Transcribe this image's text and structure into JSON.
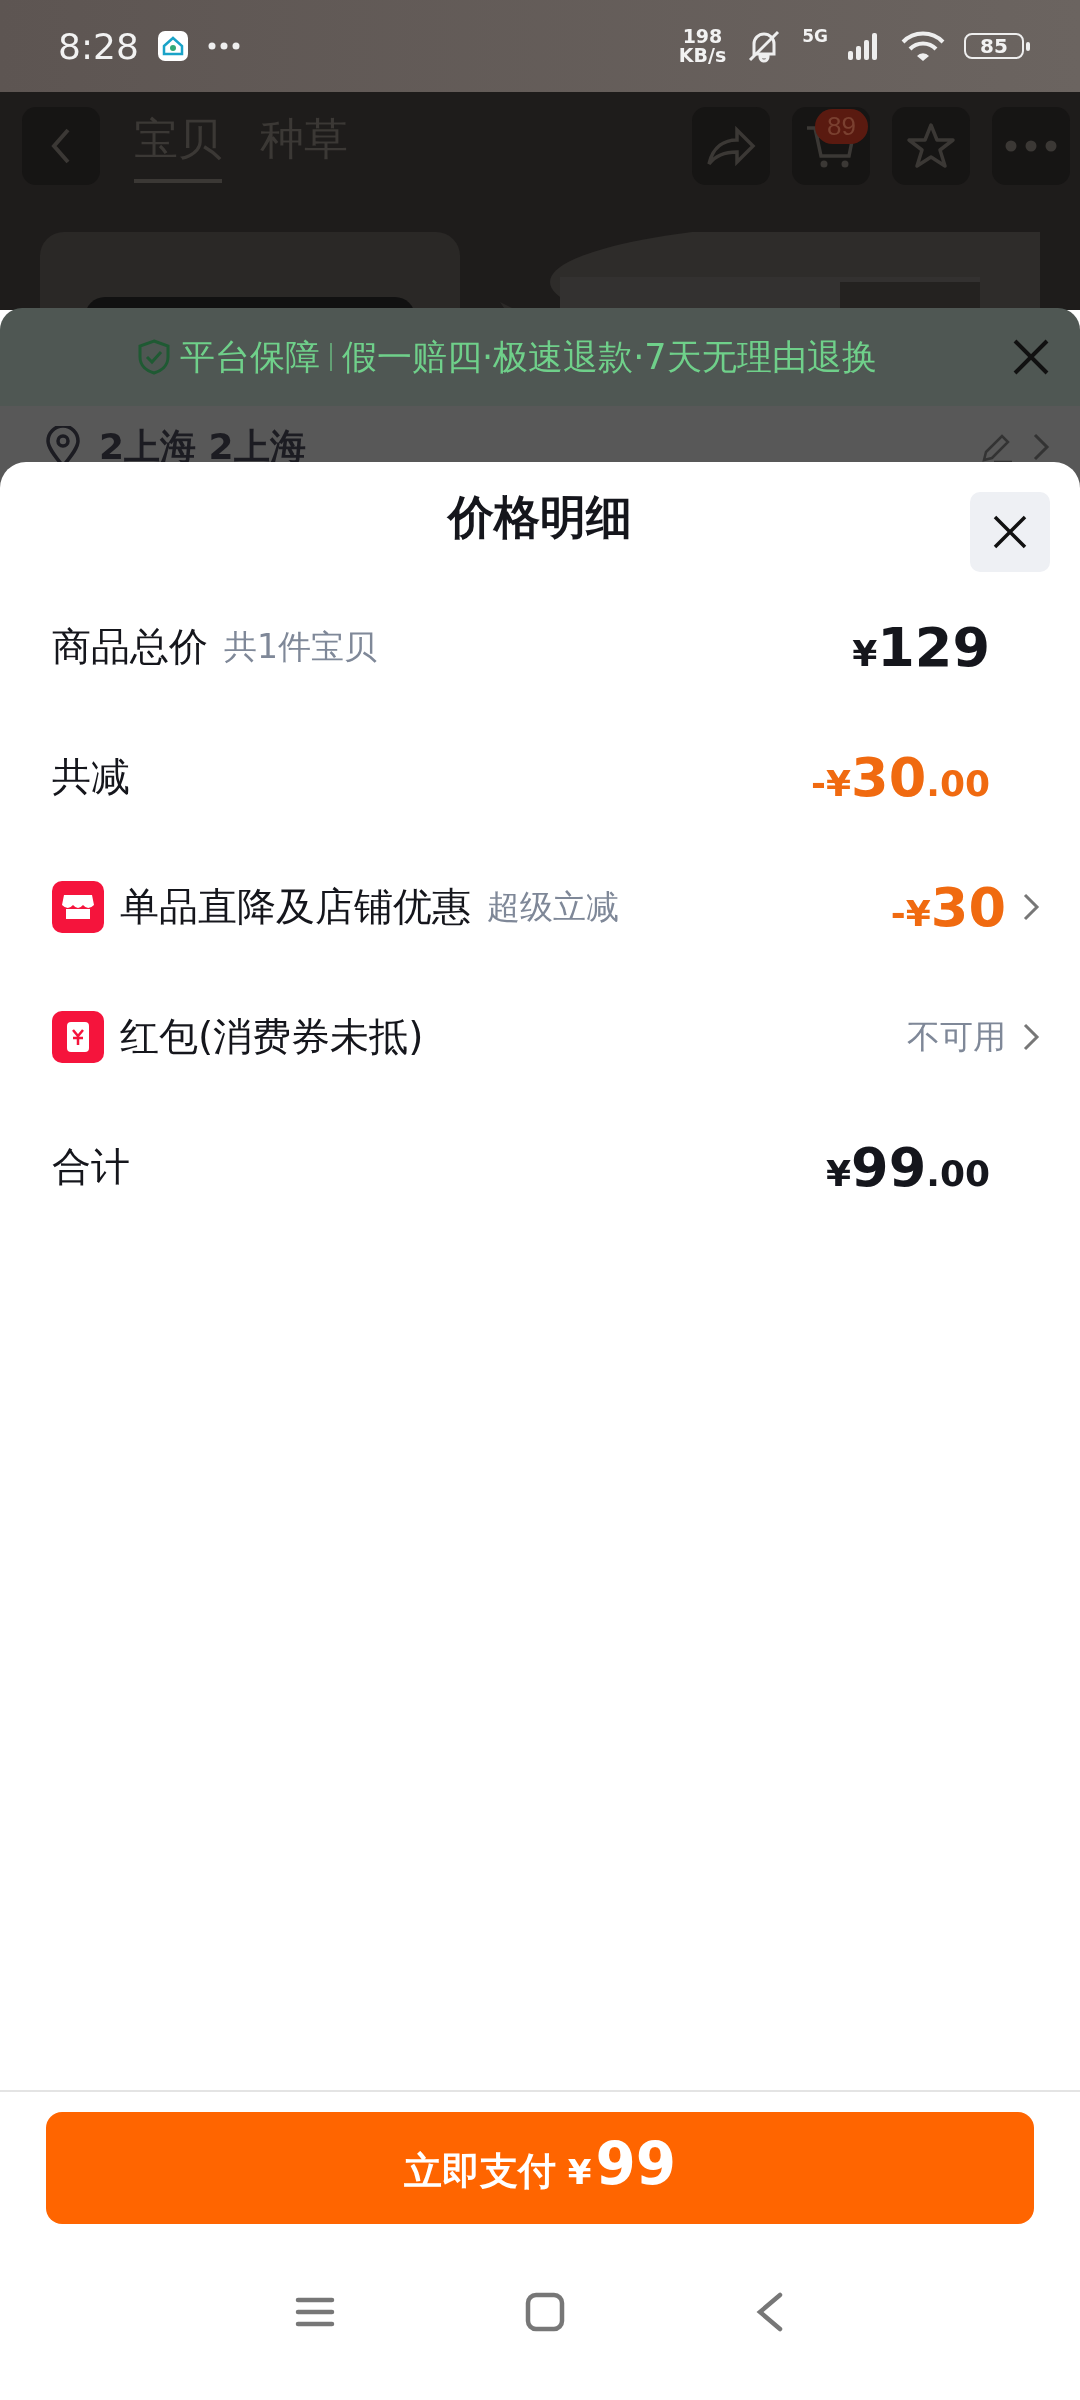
{
  "status_bar": {
    "time": "8:28",
    "net_speed": "198",
    "net_unit": "KB/s",
    "network": "5G",
    "battery": "85"
  },
  "background_page": {
    "tabs": [
      {
        "label": "宝贝",
        "selected": true
      },
      {
        "label": "种草",
        "selected": false
      }
    ],
    "cart_badge": "89",
    "guarantee": {
      "title": "平台保障",
      "text": "假一赔四·极速退款·7天无理由退换"
    },
    "address": "2上海 2上海"
  },
  "sheet": {
    "title": "价格明细",
    "rows": [
      {
        "kind": "subtotal",
        "label": "商品总价",
        "note": "共1件宝贝",
        "prefix": "¥",
        "main": "129",
        "link": false
      },
      {
        "kind": "discount",
        "label": "共减",
        "prefix": "-¥",
        "main": "30",
        "decimals": ".00",
        "link": false
      },
      {
        "kind": "store_discount",
        "label": "单品直降及店铺优惠",
        "note": "超级立减",
        "prefix": "-¥",
        "main": "30",
        "link": true
      },
      {
        "kind": "red_packet",
        "label": "红包(消费券未抵)",
        "status": "不可用",
        "link": true
      },
      {
        "kind": "total",
        "label": "合计",
        "prefix": "¥",
        "main": "99",
        "decimals": ".00",
        "link": false
      }
    ]
  },
  "pay_button": {
    "label": "立即支付",
    "currency": "¥",
    "amount": "99"
  }
}
